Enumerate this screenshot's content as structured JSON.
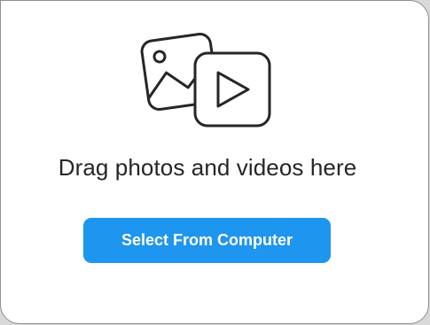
{
  "dropzone": {
    "icon": "photo-video-icon",
    "message": "Drag photos and videos here",
    "select_button_label": "Select From Computer",
    "accent_color": "#1e95ef",
    "text_color": "#262626"
  }
}
